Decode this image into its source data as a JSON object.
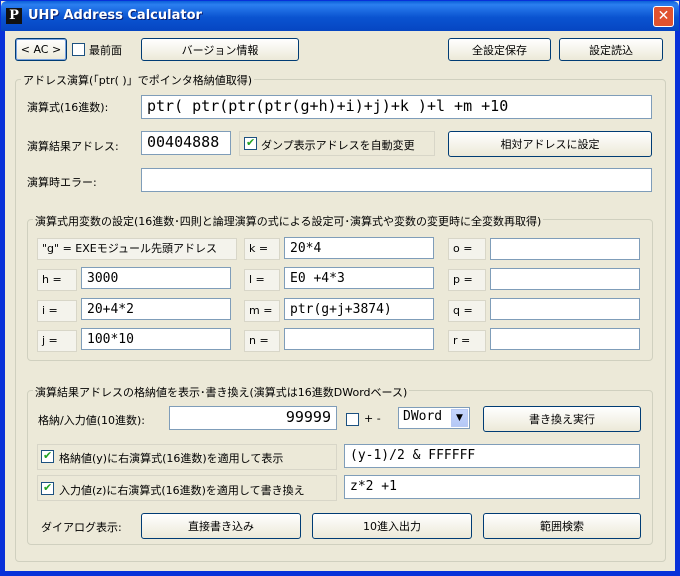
{
  "window": {
    "title": "UHP Address Calculator",
    "icon_letter": "P",
    "close_glyph": "✕"
  },
  "top": {
    "ac_button": "< AC >",
    "always_on_top_label": "最前面",
    "always_on_top_checked": false,
    "version_button": "バージョン情報",
    "save_all_button": "全設定保存",
    "load_settings_button": "設定読込"
  },
  "address_calc": {
    "group_title": "アドレス演算(「ptr( )」でポインタ格納値取得)",
    "expr_label": "演算式(16進数):",
    "expr_value": "ptr( ptr(ptr(ptr(g+h)+i)+j)+k )+l +m +10",
    "result_label": "演算結果アドレス:",
    "result_value": "00404888",
    "auto_change_label": "ダンプ表示アドレスを自動変更",
    "auto_change_checked": true,
    "set_relative_button": "相対アドレスに設定",
    "error_label": "演算時エラー:",
    "error_value": ""
  },
  "variables": {
    "group_title": "演算式用変数の設定(16進数･四則と論理演算の式による設定可･演算式や変数の変更時に全変数再取得)",
    "g_label": "\"g\" = EXEモジュール先頭アドレス",
    "h_label": "h =",
    "h_value": "3000",
    "i_label": "i =",
    "i_value": "20+4*2",
    "j_label": "j =",
    "j_value": "100*10",
    "k_label": "k =",
    "k_value": "20*4",
    "l_label": "l =",
    "l_value": "E0 +4*3",
    "m_label": "m =",
    "m_value": "ptr(g+j+3874)",
    "n_label": "n =",
    "n_value": "",
    "o_label": "o =",
    "o_value": "",
    "p_label": "p =",
    "p_value": "",
    "q_label": "q =",
    "q_value": "",
    "r_label": "r =",
    "r_value": ""
  },
  "store": {
    "group_title": "演算結果アドレスの格納値を表示･書き換え(演算式は16進数DWordベース)",
    "io_label": "格納/入力値(10進数):",
    "io_value": "99999",
    "sign_label": "+ -",
    "sign_checked": false,
    "type_value": "DWord",
    "execute_button": "書き換え実行",
    "apply_y_label": "格納値(y)に右演算式(16進数)を適用して表示",
    "apply_y_checked": true,
    "apply_y_value": "(y-1)/2 & FFFFFF",
    "apply_z_label": "入力値(z)に右演算式(16進数)を適用して書き換え",
    "apply_z_checked": true,
    "apply_z_value": "z*2 +1",
    "dialog_label": "ダイアログ表示:",
    "direct_write_button": "直接書き込み",
    "decimal_io_button": "10進入出力",
    "range_search_button": "範囲検索"
  }
}
